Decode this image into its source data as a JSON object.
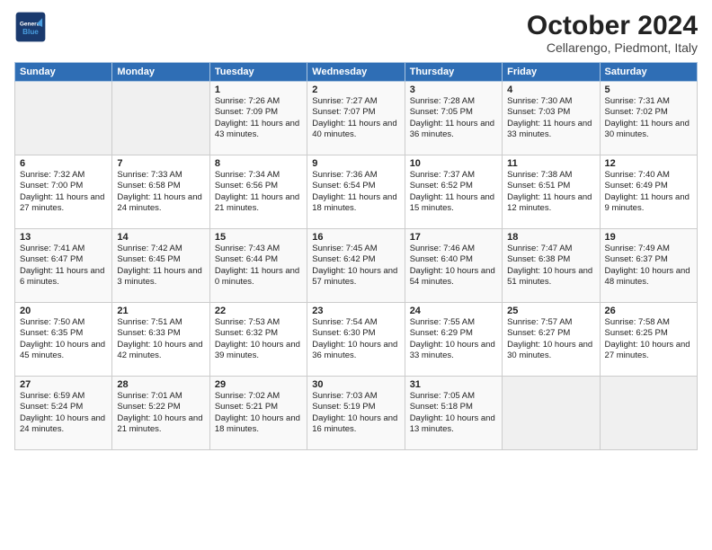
{
  "header": {
    "logo_general": "General",
    "logo_blue": "Blue",
    "month_title": "October 2024",
    "location": "Cellarengo, Piedmont, Italy"
  },
  "days_of_week": [
    "Sunday",
    "Monday",
    "Tuesday",
    "Wednesday",
    "Thursday",
    "Friday",
    "Saturday"
  ],
  "weeks": [
    [
      {
        "day": "",
        "info": ""
      },
      {
        "day": "",
        "info": ""
      },
      {
        "day": "1",
        "info": "Sunrise: 7:26 AM\nSunset: 7:09 PM\nDaylight: 11 hours and 43 minutes."
      },
      {
        "day": "2",
        "info": "Sunrise: 7:27 AM\nSunset: 7:07 PM\nDaylight: 11 hours and 40 minutes."
      },
      {
        "day": "3",
        "info": "Sunrise: 7:28 AM\nSunset: 7:05 PM\nDaylight: 11 hours and 36 minutes."
      },
      {
        "day": "4",
        "info": "Sunrise: 7:30 AM\nSunset: 7:03 PM\nDaylight: 11 hours and 33 minutes."
      },
      {
        "day": "5",
        "info": "Sunrise: 7:31 AM\nSunset: 7:02 PM\nDaylight: 11 hours and 30 minutes."
      }
    ],
    [
      {
        "day": "6",
        "info": "Sunrise: 7:32 AM\nSunset: 7:00 PM\nDaylight: 11 hours and 27 minutes."
      },
      {
        "day": "7",
        "info": "Sunrise: 7:33 AM\nSunset: 6:58 PM\nDaylight: 11 hours and 24 minutes."
      },
      {
        "day": "8",
        "info": "Sunrise: 7:34 AM\nSunset: 6:56 PM\nDaylight: 11 hours and 21 minutes."
      },
      {
        "day": "9",
        "info": "Sunrise: 7:36 AM\nSunset: 6:54 PM\nDaylight: 11 hours and 18 minutes."
      },
      {
        "day": "10",
        "info": "Sunrise: 7:37 AM\nSunset: 6:52 PM\nDaylight: 11 hours and 15 minutes."
      },
      {
        "day": "11",
        "info": "Sunrise: 7:38 AM\nSunset: 6:51 PM\nDaylight: 11 hours and 12 minutes."
      },
      {
        "day": "12",
        "info": "Sunrise: 7:40 AM\nSunset: 6:49 PM\nDaylight: 11 hours and 9 minutes."
      }
    ],
    [
      {
        "day": "13",
        "info": "Sunrise: 7:41 AM\nSunset: 6:47 PM\nDaylight: 11 hours and 6 minutes."
      },
      {
        "day": "14",
        "info": "Sunrise: 7:42 AM\nSunset: 6:45 PM\nDaylight: 11 hours and 3 minutes."
      },
      {
        "day": "15",
        "info": "Sunrise: 7:43 AM\nSunset: 6:44 PM\nDaylight: 11 hours and 0 minutes."
      },
      {
        "day": "16",
        "info": "Sunrise: 7:45 AM\nSunset: 6:42 PM\nDaylight: 10 hours and 57 minutes."
      },
      {
        "day": "17",
        "info": "Sunrise: 7:46 AM\nSunset: 6:40 PM\nDaylight: 10 hours and 54 minutes."
      },
      {
        "day": "18",
        "info": "Sunrise: 7:47 AM\nSunset: 6:38 PM\nDaylight: 10 hours and 51 minutes."
      },
      {
        "day": "19",
        "info": "Sunrise: 7:49 AM\nSunset: 6:37 PM\nDaylight: 10 hours and 48 minutes."
      }
    ],
    [
      {
        "day": "20",
        "info": "Sunrise: 7:50 AM\nSunset: 6:35 PM\nDaylight: 10 hours and 45 minutes."
      },
      {
        "day": "21",
        "info": "Sunrise: 7:51 AM\nSunset: 6:33 PM\nDaylight: 10 hours and 42 minutes."
      },
      {
        "day": "22",
        "info": "Sunrise: 7:53 AM\nSunset: 6:32 PM\nDaylight: 10 hours and 39 minutes."
      },
      {
        "day": "23",
        "info": "Sunrise: 7:54 AM\nSunset: 6:30 PM\nDaylight: 10 hours and 36 minutes."
      },
      {
        "day": "24",
        "info": "Sunrise: 7:55 AM\nSunset: 6:29 PM\nDaylight: 10 hours and 33 minutes."
      },
      {
        "day": "25",
        "info": "Sunrise: 7:57 AM\nSunset: 6:27 PM\nDaylight: 10 hours and 30 minutes."
      },
      {
        "day": "26",
        "info": "Sunrise: 7:58 AM\nSunset: 6:25 PM\nDaylight: 10 hours and 27 minutes."
      }
    ],
    [
      {
        "day": "27",
        "info": "Sunrise: 6:59 AM\nSunset: 5:24 PM\nDaylight: 10 hours and 24 minutes."
      },
      {
        "day": "28",
        "info": "Sunrise: 7:01 AM\nSunset: 5:22 PM\nDaylight: 10 hours and 21 minutes."
      },
      {
        "day": "29",
        "info": "Sunrise: 7:02 AM\nSunset: 5:21 PM\nDaylight: 10 hours and 18 minutes."
      },
      {
        "day": "30",
        "info": "Sunrise: 7:03 AM\nSunset: 5:19 PM\nDaylight: 10 hours and 16 minutes."
      },
      {
        "day": "31",
        "info": "Sunrise: 7:05 AM\nSunset: 5:18 PM\nDaylight: 10 hours and 13 minutes."
      },
      {
        "day": "",
        "info": ""
      },
      {
        "day": "",
        "info": ""
      }
    ]
  ]
}
